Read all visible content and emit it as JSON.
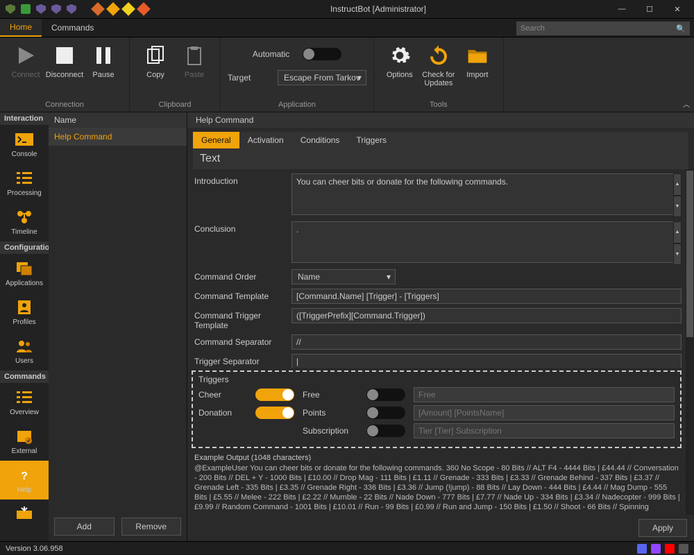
{
  "window": {
    "title": "InstructBot [Administrator]"
  },
  "tabs": {
    "home": "Home",
    "commands": "Commands"
  },
  "search": {
    "placeholder": "Search"
  },
  "ribbon": {
    "connection": {
      "label": "Connection",
      "connect": "Connect",
      "disconnect": "Disconnect",
      "pause": "Pause"
    },
    "clipboard": {
      "label": "Clipboard",
      "copy": "Copy",
      "paste": "Paste"
    },
    "application": {
      "label": "Application",
      "automatic": "Automatic",
      "target": "Target",
      "target_value": "Escape From Tarkov"
    },
    "tools": {
      "label": "Tools",
      "options": "Options",
      "check": "Check for\nUpdates",
      "import": "Import"
    }
  },
  "sidebar": {
    "interaction": "Interaction",
    "console": "Console",
    "processing": "Processing",
    "timeline": "Timeline",
    "configuration": "Configuration",
    "applications": "Applications",
    "profiles": "Profiles",
    "users": "Users",
    "commands": "Commands",
    "overview": "Overview",
    "external": "External",
    "help": "Help"
  },
  "list": {
    "header": "Name",
    "item0": "Help Command",
    "add": "Add",
    "remove": "Remove"
  },
  "content": {
    "header": "Help Command",
    "subtabs": {
      "general": "General",
      "activation": "Activation",
      "conditions": "Conditions",
      "triggers": "Triggers"
    },
    "section": "Text",
    "labels": {
      "introduction": "Introduction",
      "conclusion": "Conclusion",
      "command_order": "Command Order",
      "command_template": "Command Template",
      "command_trigger_template": "Command Trigger Template",
      "command_separator": "Command Separator",
      "trigger_separator": "Trigger Separator"
    },
    "values": {
      "introduction": "You can cheer bits or donate for the following commands.",
      "conclusion": ".",
      "command_order": "Name",
      "command_template": "[Command.Name] [Trigger] - [Triggers]",
      "command_trigger_template": "([TriggerPrefix][Command.Trigger])",
      "command_separator": "//",
      "trigger_separator": "|"
    },
    "triggers": {
      "title": "Triggers",
      "cheer": "Cheer",
      "donation": "Donation",
      "free": "Free",
      "points": "Points",
      "subscription": "Subscription",
      "free_ph": "Free",
      "points_ph": "[Amount] [PointsName]",
      "sub_ph": "Tier [Tier] Subscription"
    },
    "example": {
      "header": "Example Output (1048 characters)",
      "text": "@ExampleUser You can cheer bits or donate for the following commands. 360 No Scope  - 80 Bits // ALT F4  - 4444 Bits | £44.44 // Conversation  - 200 Bits // DEL + Y  - 1000 Bits | £10.00 // Drop Mag  - 111 Bits | £1.11 // Grenade  - 333 Bits | £3.33 // Grenade Behind  - 337 Bits | £3.37 // Grenade Left  - 335 Bits | £3.35 // Grenade Right  - 336 Bits | £3.36 // Jump  (!jump) - 88 Bits // Lay Down  - 444 Bits | £4.44 // Mag Dump  - 555 Bits | £5.55 // Melee  - 222 Bits | £2.22 // Mumble  - 22 Bits // Nade Down  - 777 Bits | £7.77 // Nade Up  - 334 Bits | £3.34 // Nadecopter  - 999 Bits | £9.99 // Random Command  - 1001 Bits | £10.01 // Run  - 99 Bits | £0.99 // Run and Jump  - 150 Bits | £1.50 // Shoot  - 66 Bits // Spinning"
    },
    "apply": "Apply"
  },
  "status": {
    "version": "Version 3.06.958"
  }
}
